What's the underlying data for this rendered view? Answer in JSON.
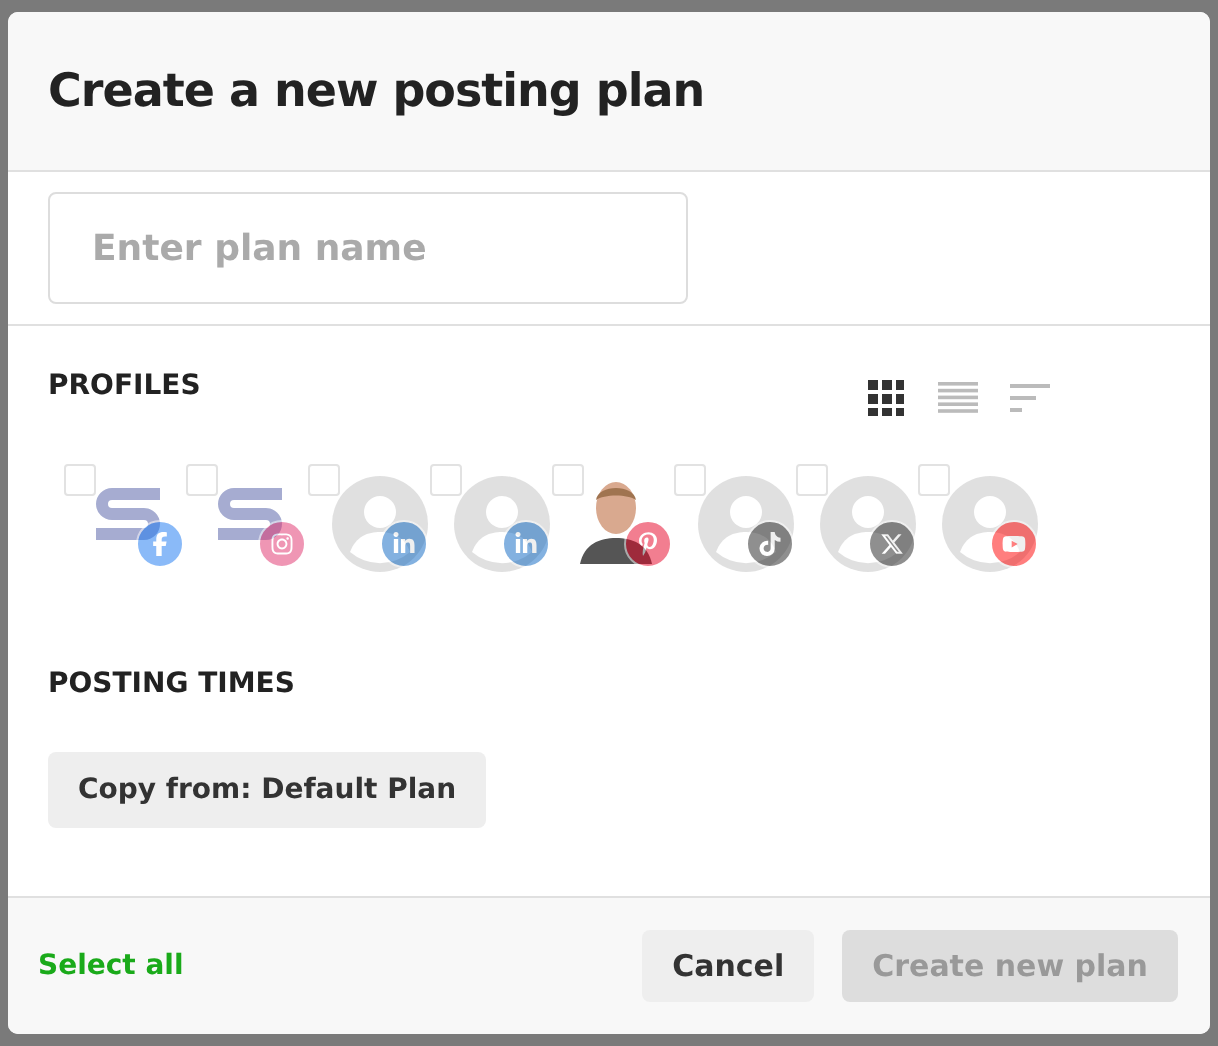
{
  "dialog": {
    "title": "Create a new posting plan"
  },
  "plan_name": {
    "placeholder": "Enter plan name"
  },
  "profiles": {
    "heading": "PROFILES",
    "views": [
      {
        "kind": "grid",
        "selected": true
      },
      {
        "kind": "list",
        "selected": false
      },
      {
        "kind": "sort",
        "selected": false
      }
    ],
    "items": [
      {
        "avatar": {
          "kind": "logo"
        },
        "badge": {
          "kind": "facebook"
        },
        "checked": false
      },
      {
        "avatar": {
          "kind": "logo"
        },
        "badge": {
          "kind": "instagram"
        },
        "checked": false
      },
      {
        "avatar": {
          "kind": "person"
        },
        "badge": {
          "kind": "linkedin"
        },
        "checked": false
      },
      {
        "avatar": {
          "kind": "person"
        },
        "badge": {
          "kind": "linkedin"
        },
        "checked": false
      },
      {
        "avatar": {
          "kind": "photo"
        },
        "badge": {
          "kind": "pinterest"
        },
        "checked": false
      },
      {
        "avatar": {
          "kind": "person"
        },
        "badge": {
          "kind": "tiktok"
        },
        "checked": false
      },
      {
        "avatar": {
          "kind": "person"
        },
        "badge": {
          "kind": "x"
        },
        "checked": false
      },
      {
        "avatar": {
          "kind": "person"
        },
        "badge": {
          "kind": "youtube"
        },
        "checked": false
      }
    ]
  },
  "posting_times": {
    "heading": "POSTING TIMES",
    "copy_button": "Copy from: Default Plan"
  },
  "footer": {
    "select_all": "Select all",
    "cancel": "Cancel",
    "create": {
      "label": "Create new plan",
      "disabled": true
    }
  }
}
